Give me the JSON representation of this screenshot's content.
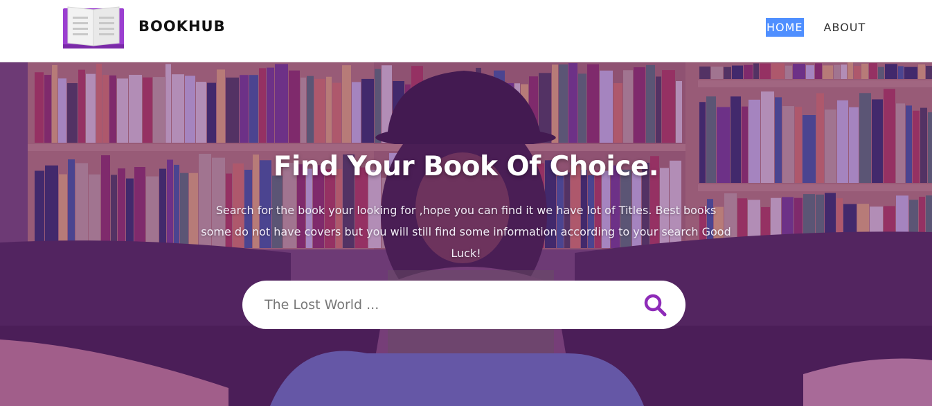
{
  "header": {
    "brand": "BOOKHUB",
    "logo_icon": "open-book-icon",
    "nav": {
      "home": "HOME",
      "about": "ABOUT"
    }
  },
  "hero": {
    "title": "Find Your Book Of Choice.",
    "description": "Search for the book your looking for ,hope you can find it we have lot of Titles. Best books some do not have covers but you will still find some information according to your search Good Luck!",
    "search": {
      "placeholder": "The Lost World ...",
      "value": "",
      "button_icon": "search-icon"
    }
  },
  "colors": {
    "accent": "#8e2bb8",
    "overlay": "#702896",
    "nav_active_bg": "#4f8fff",
    "logo_purple": "#9b3fd0"
  }
}
